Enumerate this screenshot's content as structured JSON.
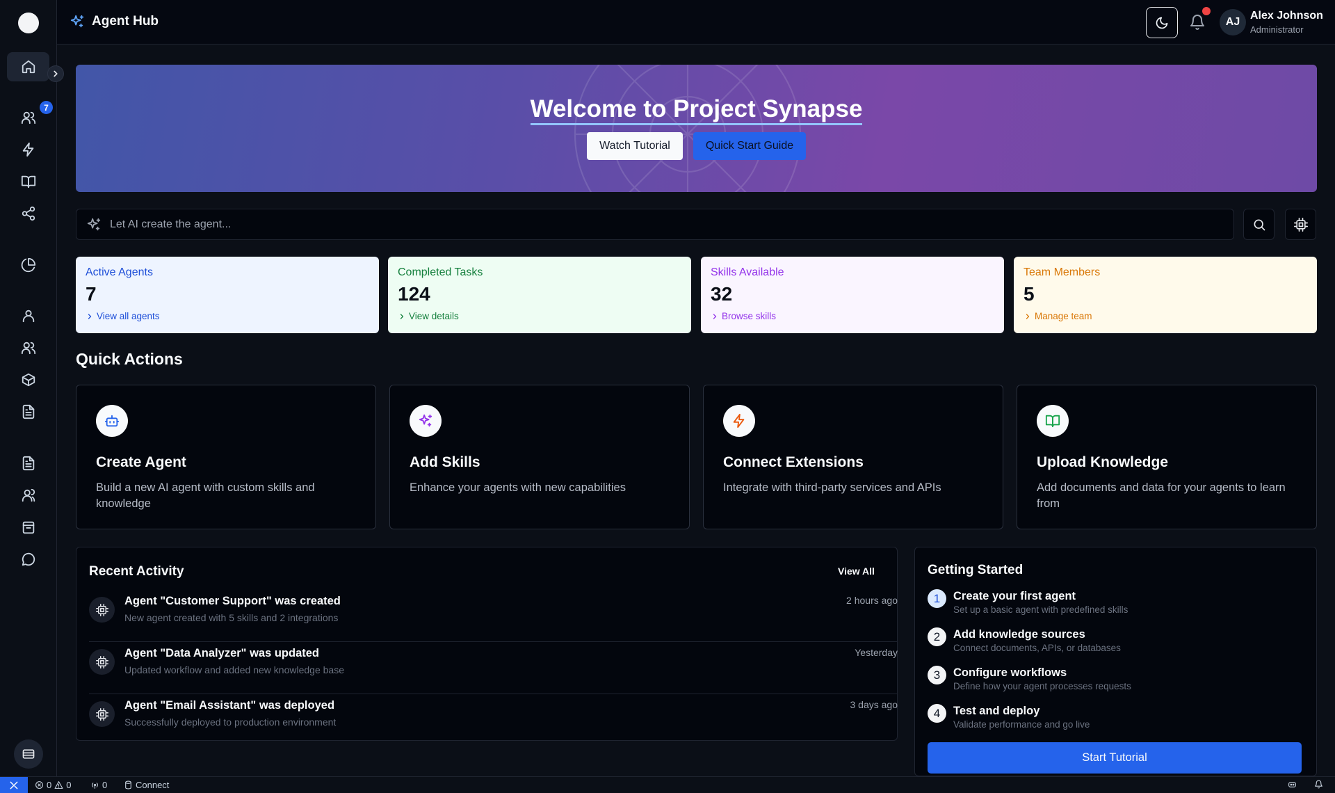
{
  "app": {
    "title": "Agent Hub"
  },
  "sidebar": {
    "badge_count": "7",
    "items": [
      {
        "icon": "home-icon",
        "active": true
      },
      {
        "icon": "users-icon"
      },
      {
        "icon": "lightning-icon"
      },
      {
        "icon": "book-icon"
      },
      {
        "icon": "share-icon"
      },
      {
        "icon": "pie-chart-icon"
      },
      {
        "icon": "user-icon"
      },
      {
        "icon": "users-icon"
      },
      {
        "icon": "box-icon"
      },
      {
        "icon": "document-icon"
      },
      {
        "icon": "document-icon"
      },
      {
        "icon": "team-icon"
      },
      {
        "icon": "archive-icon"
      },
      {
        "icon": "chat-icon"
      }
    ]
  },
  "user": {
    "initials": "AJ",
    "name": "Alex Johnson",
    "role": "Administrator"
  },
  "banner": {
    "title": "Welcome to Project Synapse",
    "watch_label": "Watch Tutorial",
    "quick_label": "Quick Start Guide"
  },
  "prompt": {
    "placeholder": "Let AI create the agent..."
  },
  "stats": [
    {
      "label": "Active Agents",
      "value": "7",
      "link": "View all agents",
      "bg": "#eef4ff",
      "color": "#1d4ed8"
    },
    {
      "label": "Completed Tasks",
      "value": "124",
      "link": "View details",
      "bg": "#eefdf3",
      "color": "#15803d"
    },
    {
      "label": "Skills Available",
      "value": "32",
      "link": "Browse skills",
      "bg": "#faf5ff",
      "color": "#9333ea"
    },
    {
      "label": "Team Members",
      "value": "5",
      "link": "Manage team",
      "bg": "#fffaeb",
      "color": "#d97706"
    }
  ],
  "quick_actions": {
    "title": "Quick Actions",
    "items": [
      {
        "title": "Create Agent",
        "desc": "Build a new AI agent with custom skills and knowledge",
        "icon": "robot-icon",
        "color": "#2563eb"
      },
      {
        "title": "Add Skills",
        "desc": "Enhance your agents with new capabilities",
        "icon": "sparkles-icon",
        "color": "#9333ea"
      },
      {
        "title": "Connect Extensions",
        "desc": "Integrate with third-party services and APIs",
        "icon": "lightning-icon",
        "color": "#ea580c"
      },
      {
        "title": "Upload Knowledge",
        "desc": "Add documents and data for your agents to learn from",
        "icon": "book-icon",
        "color": "#16a34a"
      }
    ]
  },
  "recent_activity": {
    "title": "Recent Activity",
    "view_all": "View All",
    "items": [
      {
        "title": "Agent \"Customer Support\" was created",
        "desc": "New agent created with 5 skills and 2 integrations",
        "time": "2 hours ago"
      },
      {
        "title": "Agent \"Data Analyzer\" was updated",
        "desc": "Updated workflow and added new knowledge base",
        "time": "Yesterday"
      },
      {
        "title": "Agent \"Email Assistant\" was deployed",
        "desc": "Successfully deployed to production environment",
        "time": "3 days ago"
      }
    ]
  },
  "getting_started": {
    "title": "Getting Started",
    "steps": [
      {
        "num": "1",
        "title": "Create your first agent",
        "desc": "Set up a basic agent with predefined skills"
      },
      {
        "num": "2",
        "title": "Add knowledge sources",
        "desc": "Connect documents, APIs, or databases"
      },
      {
        "num": "3",
        "title": "Configure workflows",
        "desc": "Define how your agent processes requests"
      },
      {
        "num": "4",
        "title": "Test and deploy",
        "desc": "Validate performance and go live"
      }
    ],
    "button": "Start Tutorial"
  },
  "statusbar": {
    "errors": "0",
    "warnings": "0",
    "ports": "0",
    "connect": "Connect"
  }
}
